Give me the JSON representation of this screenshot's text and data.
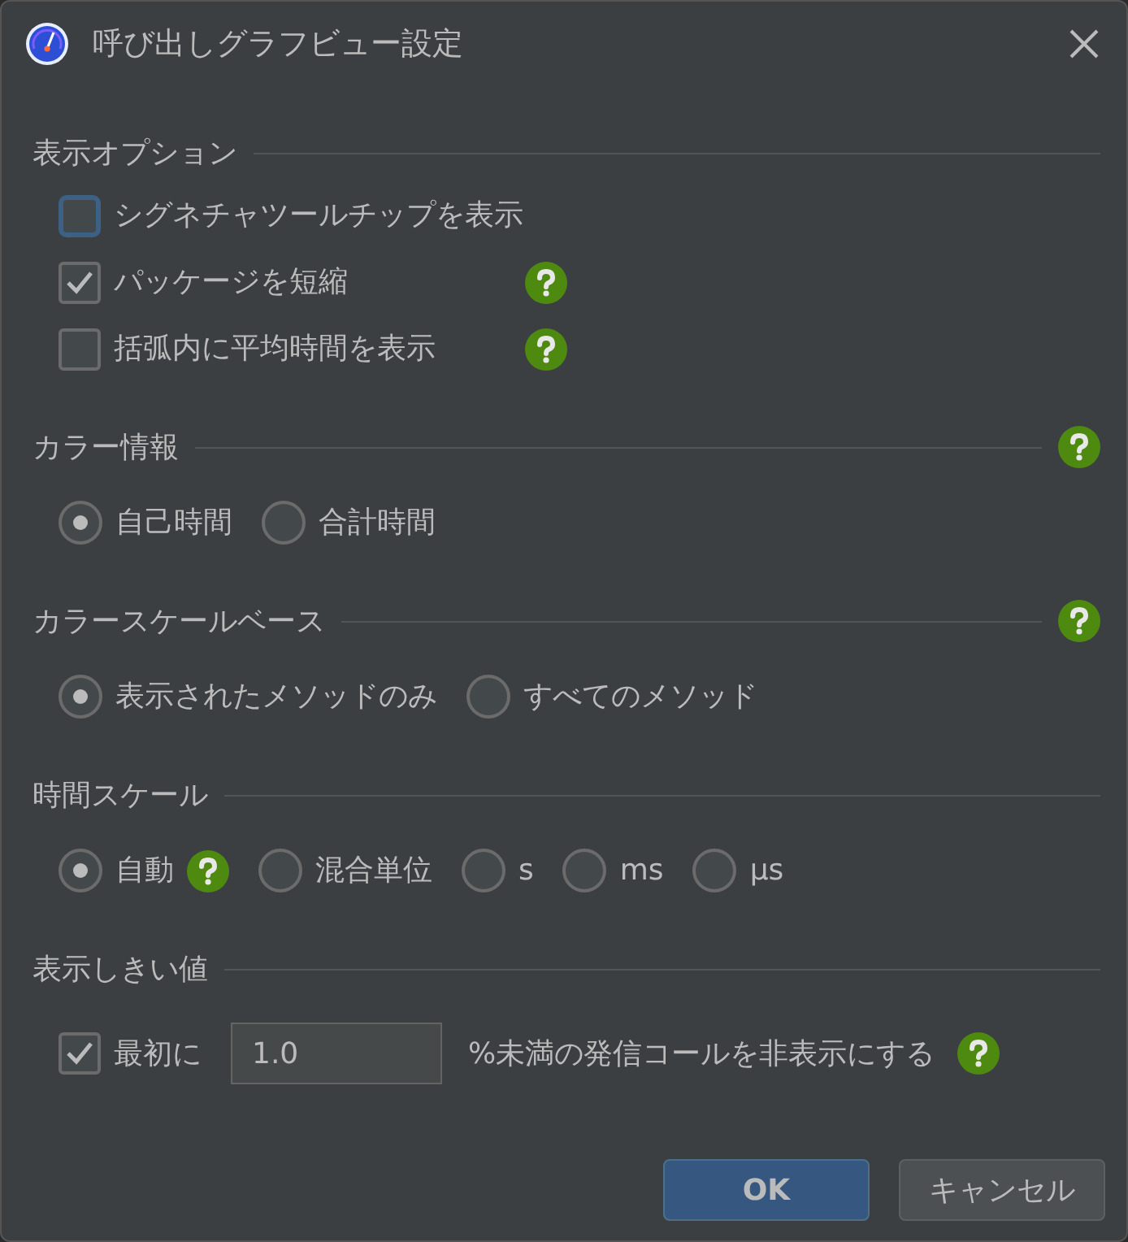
{
  "window": {
    "title": "呼び出しグラフビュー設定"
  },
  "sections": [
    {
      "title": "表示オプション",
      "help": false,
      "options": [
        {
          "kind": "checkbox",
          "label": "シグネチャツールチップを表示",
          "checked": false,
          "focused": true,
          "help": false
        },
        {
          "kind": "checkbox",
          "label": "パッケージを短縮",
          "checked": true,
          "focused": false,
          "help": true
        },
        {
          "kind": "checkbox",
          "label": "括弧内に平均時間を表示",
          "checked": false,
          "focused": false,
          "help": true
        }
      ]
    },
    {
      "title": "カラー情報",
      "help": true,
      "options": [
        {
          "kind": "radio",
          "label": "自己時間",
          "selected": true,
          "help": false
        },
        {
          "kind": "radio",
          "label": "合計時間",
          "selected": false,
          "help": false
        }
      ]
    },
    {
      "title": "カラースケールベース",
      "help": true,
      "options": [
        {
          "kind": "radio",
          "label": "表示されたメソッドのみ",
          "selected": true,
          "help": false
        },
        {
          "kind": "radio",
          "label": "すべてのメソッド",
          "selected": false,
          "help": false
        }
      ]
    },
    {
      "title": "時間スケール",
      "help": false,
      "options": [
        {
          "kind": "radio",
          "label": "自動",
          "selected": true,
          "help": true
        },
        {
          "kind": "radio",
          "label": "混合単位",
          "selected": false,
          "help": false
        },
        {
          "kind": "radio",
          "label": "s",
          "selected": false,
          "help": false
        },
        {
          "kind": "radio",
          "label": "ms",
          "selected": false,
          "help": false
        },
        {
          "kind": "radio",
          "label": "μs",
          "selected": false,
          "help": false
        }
      ]
    },
    {
      "title": "表示しきい値",
      "help": false,
      "options": [
        {
          "kind": "threshold",
          "label": "最初に",
          "checked": true,
          "value": "1.0",
          "suffix": "%未満の発信コールを非表示にする",
          "help": true
        }
      ]
    }
  ],
  "buttons": [
    {
      "label": "OK",
      "primary": true
    },
    {
      "label": "キャンセル",
      "primary": false
    }
  ]
}
